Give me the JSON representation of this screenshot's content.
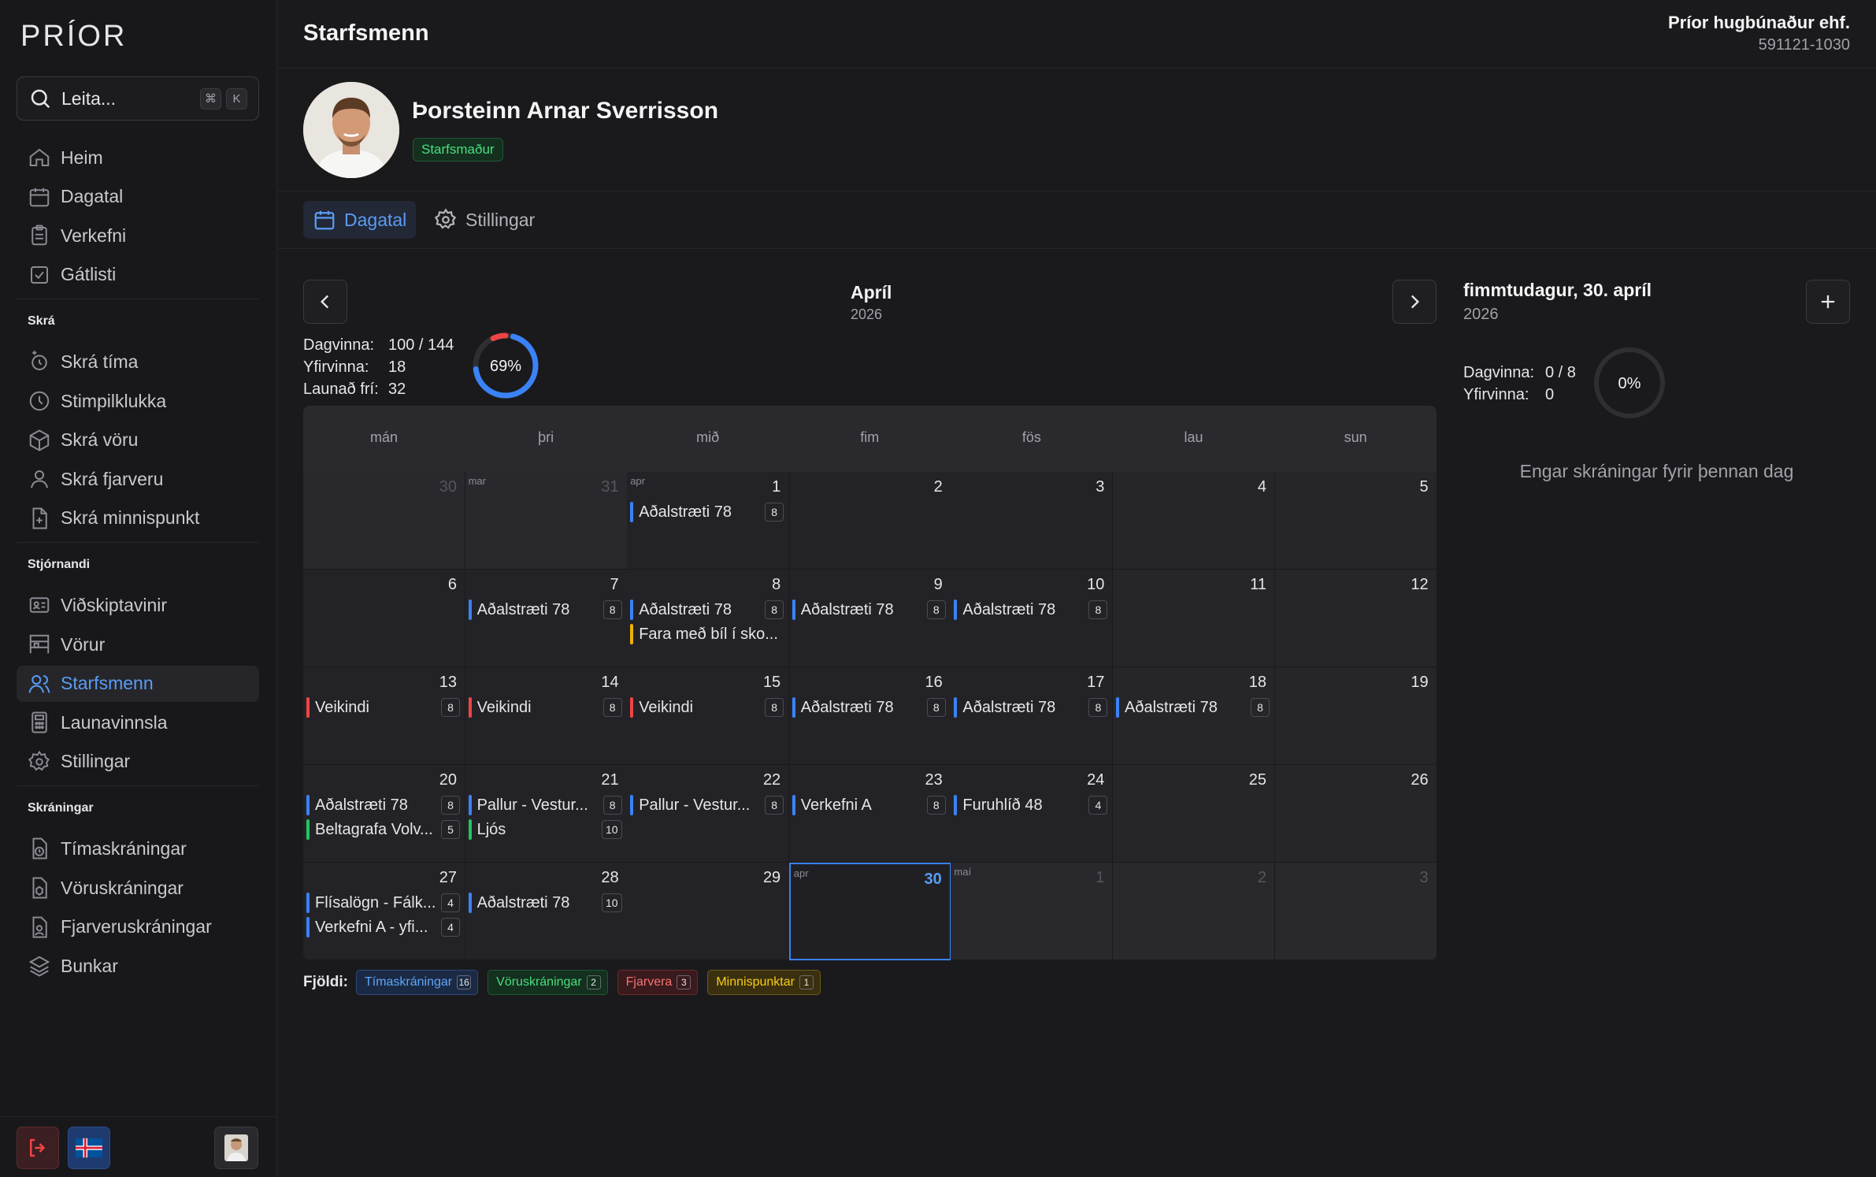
{
  "app": {
    "logo_text": "PRÍOR"
  },
  "search": {
    "placeholder": "Leita...",
    "kbd1": "⌘",
    "kbd2": "K"
  },
  "sidebar": {
    "main": [
      {
        "label": "Heim",
        "icon": "home-icon"
      },
      {
        "label": "Dagatal",
        "icon": "calendar-icon"
      },
      {
        "label": "Verkefni",
        "icon": "clipboard-icon"
      },
      {
        "label": "Gátlisti",
        "icon": "checkbox-icon"
      }
    ],
    "section_skra": "Skrá",
    "skra": [
      {
        "label": "Skrá tíma",
        "icon": "clock-plus-icon"
      },
      {
        "label": "Stimpilklukka",
        "icon": "clock-icon"
      },
      {
        "label": "Skrá vöru",
        "icon": "box-icon"
      },
      {
        "label": "Skrá fjarveru",
        "icon": "user-icon"
      },
      {
        "label": "Skrá minnispunkt",
        "icon": "file-plus-icon"
      }
    ],
    "section_stjornandi": "Stjórnandi",
    "stjornandi": [
      {
        "label": "Viðskiptavinir",
        "icon": "id-card-icon"
      },
      {
        "label": "Vörur",
        "icon": "shelf-icon"
      },
      {
        "label": "Starfsmenn",
        "icon": "users-icon",
        "active": true
      },
      {
        "label": "Launavinnsla",
        "icon": "calculator-icon"
      },
      {
        "label": "Stillingar",
        "icon": "gear-icon"
      }
    ],
    "section_skraningar": "Skráningar",
    "skraningar": [
      {
        "label": "Tímaskráningar",
        "icon": "time-file-icon"
      },
      {
        "label": "Vöruskráningar",
        "icon": "product-file-icon"
      },
      {
        "label": "Fjarveruskráningar",
        "icon": "absence-file-icon"
      },
      {
        "label": "Bunkar",
        "icon": "layers-icon"
      }
    ]
  },
  "header": {
    "title": "Starfsmenn",
    "company": "Príor hugbúnaður ehf.",
    "company_id": "591121-1030"
  },
  "profile": {
    "name": "Þorsteinn Arnar Sverrisson",
    "role": "Starfsmaður"
  },
  "tabs": [
    {
      "label": "Dagatal",
      "active": true
    },
    {
      "label": "Stillingar",
      "active": false
    }
  ],
  "calendar": {
    "month": "Apríl",
    "year": "2026",
    "stats": [
      {
        "label": "Dagvinna:",
        "value": "100 / 144"
      },
      {
        "label": "Yfirvinna:",
        "value": "18"
      },
      {
        "label": "Launað frí:",
        "value": "32"
      }
    ],
    "progress_percent": 69,
    "progress_label": "69%",
    "weekdays": [
      "mán",
      "þri",
      "mið",
      "fim",
      "fös",
      "lau",
      "sun"
    ],
    "colors": {
      "time": "#3b82f6",
      "product": "#22c55e",
      "absence": "#ef4444",
      "note": "#eab308"
    },
    "days": [
      {
        "n": "30",
        "other": true,
        "events": []
      },
      {
        "n": "31",
        "other": true,
        "mlabel": "mar",
        "events": []
      },
      {
        "n": "1",
        "mlabel": "apr",
        "events": [
          {
            "t": "Aðalstræti 78",
            "c": "8",
            "k": "time"
          }
        ]
      },
      {
        "n": "2",
        "events": []
      },
      {
        "n": "3",
        "events": []
      },
      {
        "n": "4",
        "events": []
      },
      {
        "n": "5",
        "events": []
      },
      {
        "n": "6",
        "events": []
      },
      {
        "n": "7",
        "events": [
          {
            "t": "Aðalstræti 78",
            "c": "8",
            "k": "time"
          }
        ]
      },
      {
        "n": "8",
        "events": [
          {
            "t": "Aðalstræti 78",
            "c": "8",
            "k": "time"
          },
          {
            "t": "Fara með bíl í sko...",
            "c": "",
            "k": "note"
          }
        ]
      },
      {
        "n": "9",
        "events": [
          {
            "t": "Aðalstræti 78",
            "c": "8",
            "k": "time"
          }
        ]
      },
      {
        "n": "10",
        "events": [
          {
            "t": "Aðalstræti 78",
            "c": "8",
            "k": "time"
          }
        ]
      },
      {
        "n": "11",
        "events": []
      },
      {
        "n": "12",
        "events": []
      },
      {
        "n": "13",
        "events": [
          {
            "t": "Veikindi",
            "c": "8",
            "k": "absence"
          }
        ]
      },
      {
        "n": "14",
        "events": [
          {
            "t": "Veikindi",
            "c": "8",
            "k": "absence"
          }
        ]
      },
      {
        "n": "15",
        "events": [
          {
            "t": "Veikindi",
            "c": "8",
            "k": "absence"
          }
        ]
      },
      {
        "n": "16",
        "events": [
          {
            "t": "Aðalstræti 78",
            "c": "8",
            "k": "time"
          }
        ]
      },
      {
        "n": "17",
        "events": [
          {
            "t": "Aðalstræti 78",
            "c": "8",
            "k": "time"
          }
        ]
      },
      {
        "n": "18",
        "events": [
          {
            "t": "Aðalstræti 78",
            "c": "8",
            "k": "time"
          }
        ]
      },
      {
        "n": "19",
        "events": []
      },
      {
        "n": "20",
        "events": [
          {
            "t": "Aðalstræti 78",
            "c": "8",
            "k": "time"
          },
          {
            "t": "Beltagrafa Volv...",
            "c": "5",
            "k": "product"
          }
        ]
      },
      {
        "n": "21",
        "events": [
          {
            "t": "Pallur - Vestur...",
            "c": "8",
            "k": "time"
          },
          {
            "t": "Ljós",
            "c": "10",
            "k": "product"
          }
        ]
      },
      {
        "n": "22",
        "events": [
          {
            "t": "Pallur - Vestur...",
            "c": "8",
            "k": "time"
          }
        ]
      },
      {
        "n": "23",
        "events": [
          {
            "t": "Verkefni A",
            "c": "8",
            "k": "time"
          }
        ]
      },
      {
        "n": "24",
        "events": [
          {
            "t": "Furuhlíð 48",
            "c": "4",
            "k": "time"
          }
        ]
      },
      {
        "n": "25",
        "events": []
      },
      {
        "n": "26",
        "events": []
      },
      {
        "n": "27",
        "events": [
          {
            "t": "Flísalögn - Fálk...",
            "c": "4",
            "k": "time"
          },
          {
            "t": "Verkefni A - yfi...",
            "c": "4",
            "k": "time"
          }
        ]
      },
      {
        "n": "28",
        "events": [
          {
            "t": "Aðalstræti 78",
            "c": "10",
            "k": "time"
          }
        ]
      },
      {
        "n": "29",
        "events": []
      },
      {
        "n": "30",
        "mlabel": "apr",
        "selected": true,
        "events": []
      },
      {
        "n": "1",
        "other": true,
        "mlabel": "maí",
        "events": []
      },
      {
        "n": "2",
        "other": true,
        "events": []
      },
      {
        "n": "3",
        "other": true,
        "events": []
      }
    ]
  },
  "legend": {
    "label": "Fjöldi:",
    "items": [
      {
        "label": "Tímaskráningar",
        "count": "16",
        "color": "#60a5fa",
        "bg": "#1b2a44",
        "border": "#2d4a7a"
      },
      {
        "label": "Vöruskráningar",
        "count": "2",
        "color": "#4ade80",
        "bg": "#14301e",
        "border": "#1f5a33"
      },
      {
        "label": "Fjarvera",
        "count": "3",
        "color": "#f87171",
        "bg": "#3a1a1d",
        "border": "#6a2a2e"
      },
      {
        "label": "Minnispunktar",
        "count": "1",
        "color": "#facc15",
        "bg": "#3a3010",
        "border": "#6a5a1a"
      }
    ]
  },
  "day_panel": {
    "title": "fimmtudagur, 30. apríl",
    "year": "2026",
    "stats": [
      {
        "label": "Dagvinna:",
        "value": "0 / 8"
      },
      {
        "label": "Yfirvinna:",
        "value": "0"
      }
    ],
    "progress_label": "0%",
    "progress_percent": 0,
    "empty_message": "Engar skráningar fyrir þennan dag"
  }
}
